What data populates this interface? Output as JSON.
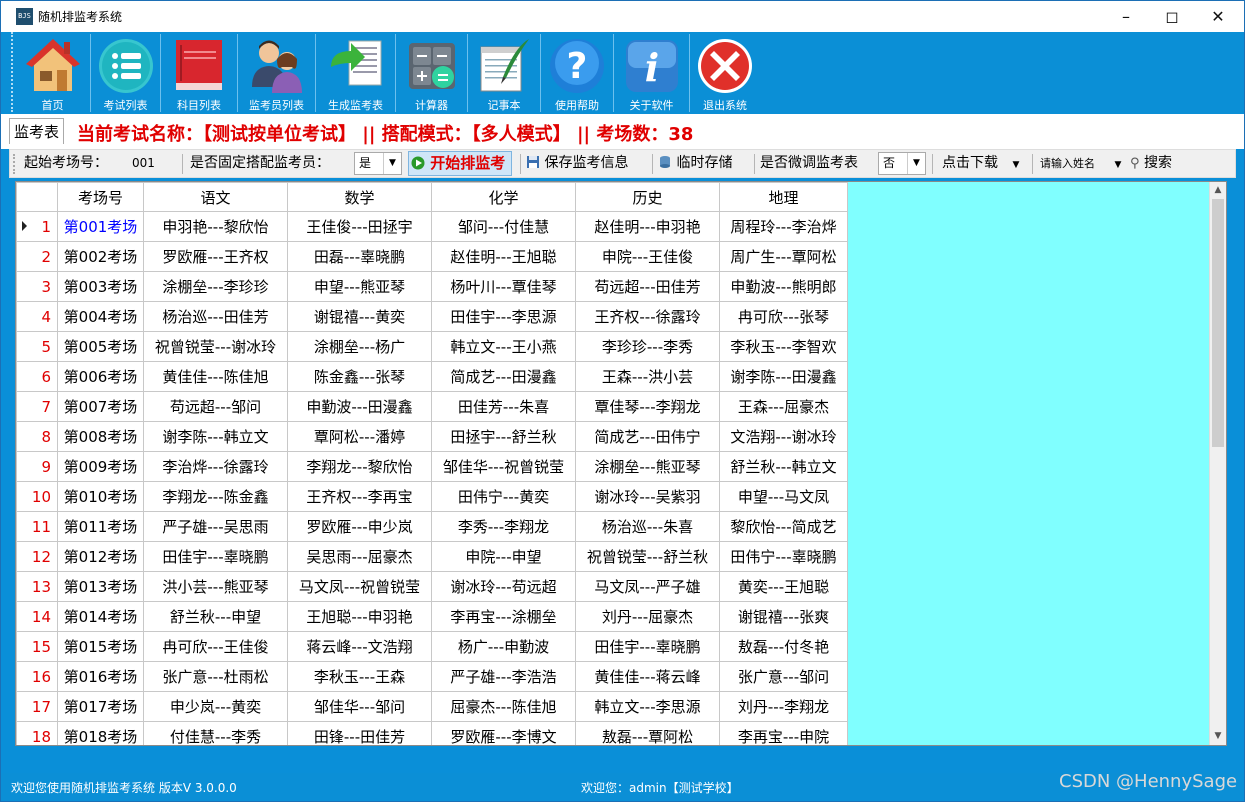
{
  "window": {
    "title": "随机排监考系统",
    "app_icon": "BJS"
  },
  "toolbar": {
    "items": [
      {
        "label": "首页",
        "icon": "home-icon"
      },
      {
        "label": "考试列表",
        "icon": "list-icon"
      },
      {
        "label": "科目列表",
        "icon": "book-icon"
      },
      {
        "label": "监考员列表",
        "icon": "users-icon"
      },
      {
        "label": "生成监考表",
        "icon": "generate-table-icon"
      },
      {
        "label": "计算器",
        "icon": "calculator-icon"
      },
      {
        "label": "记事本",
        "icon": "notepad-icon"
      },
      {
        "label": "使用帮助",
        "icon": "help-icon"
      },
      {
        "label": "关于软件",
        "icon": "info-icon"
      },
      {
        "label": "退出系统",
        "icon": "exit-icon"
      }
    ]
  },
  "info": {
    "tab": "监考表",
    "exam_text": "当前考试名称：【测试按单位考试】 || 搭配模式：【多人模式】 || 考场数：38"
  },
  "controls": {
    "start_room_label": "起始考场号：",
    "start_room_value": "001",
    "fixed_label": "是否固定搭配监考员：",
    "fixed_value": "是",
    "start_btn": "开始排监考",
    "save_btn": "保存监考信息",
    "temp_btn": "临时存储",
    "fine_tune_label": "是否微调监考表",
    "fine_tune_value": "否",
    "download_btn": "点击下载",
    "name_placeholder": "请输入姓名",
    "search_btn": "搜索"
  },
  "table": {
    "headers": [
      "考场号",
      "语文",
      "数学",
      "化学",
      "历史",
      "地理"
    ],
    "rows": [
      {
        "n": "1",
        "cells": [
          "第001考场",
          "申羽艳---黎欣怡",
          "王佳俊---田拯宇",
          "邹问---付佳慧",
          "赵佳明---申羽艳",
          "周程玲---李治烨"
        ]
      },
      {
        "n": "2",
        "cells": [
          "第002考场",
          "罗欧雁---王齐权",
          "田磊---辜晓鹏",
          "赵佳明---王旭聪",
          "申院---王佳俊",
          "周广生---覃阿松"
        ]
      },
      {
        "n": "3",
        "cells": [
          "第003考场",
          "涂棚垒---李珍珍",
          "申望---熊亚琴",
          "杨叶川---覃佳琴",
          "苟远超---田佳芳",
          "申勤波---熊明郎"
        ]
      },
      {
        "n": "4",
        "cells": [
          "第004考场",
          "杨治巡---田佳芳",
          "谢锟禧---黄奕",
          "田佳宇---李思源",
          "王齐权---徐露玲",
          "冉可欣---张琴"
        ]
      },
      {
        "n": "5",
        "cells": [
          "第005考场",
          "祝曾锐莹---谢冰玲",
          "涂棚垒---杨广",
          "韩立文---王小燕",
          "李珍珍---李秀",
          "李秋玉---李智欢"
        ]
      },
      {
        "n": "6",
        "cells": [
          "第006考场",
          "黄佳佳---陈佳旭",
          "陈金鑫---张琴",
          "简成艺---田漫鑫",
          "王森---洪小芸",
          "谢李陈---田漫鑫"
        ]
      },
      {
        "n": "7",
        "cells": [
          "第007考场",
          "苟远超---邹问",
          "申勤波---田漫鑫",
          "田佳芳---朱喜",
          "覃佳琴---李翔龙",
          "王森---屈豪杰"
        ]
      },
      {
        "n": "8",
        "cells": [
          "第008考场",
          "谢李陈---韩立文",
          "覃阿松---潘婷",
          "田拯宇---舒兰秋",
          "简成艺---田伟宁",
          "文浩翔---谢冰玲"
        ]
      },
      {
        "n": "9",
        "cells": [
          "第009考场",
          "李治烨---徐露玲",
          "李翔龙---黎欣怡",
          "邹佳华---祝曾锐莹",
          "涂棚垒---熊亚琴",
          "舒兰秋---韩立文"
        ]
      },
      {
        "n": "10",
        "cells": [
          "第010考场",
          "李翔龙---陈金鑫",
          "王齐权---李再宝",
          "田伟宁---黄奕",
          "谢冰玲---吴紫羽",
          "申望---马文凤"
        ]
      },
      {
        "n": "11",
        "cells": [
          "第011考场",
          "严子雄---吴思雨",
          "罗欧雁---申少岚",
          "李秀---李翔龙",
          "杨治巡---朱喜",
          "黎欣怡---简成艺"
        ]
      },
      {
        "n": "12",
        "cells": [
          "第012考场",
          "田佳宇---辜晓鹏",
          "吴思雨---屈豪杰",
          "申院---申望",
          "祝曾锐莹---舒兰秋",
          "田伟宁---辜晓鹏"
        ]
      },
      {
        "n": "13",
        "cells": [
          "第013考场",
          "洪小芸---熊亚琴",
          "马文凤---祝曾锐莹",
          "谢冰玲---苟远超",
          "马文凤---严子雄",
          "黄奕---王旭聪"
        ]
      },
      {
        "n": "14",
        "cells": [
          "第014考场",
          "舒兰秋---申望",
          "王旭聪---申羽艳",
          "李再宝---涂棚垒",
          "刘丹---屈豪杰",
          "谢锟禧---张爽"
        ]
      },
      {
        "n": "15",
        "cells": [
          "第015考场",
          "冉可欣---王佳俊",
          "蒋云峰---文浩翔",
          "杨广---申勤波",
          "田佳宇---辜晓鹏",
          "敖磊---付冬艳"
        ]
      },
      {
        "n": "16",
        "cells": [
          "第016考场",
          "张广意---杜雨松",
          "李秋玉---王森",
          "严子雄---李浩浩",
          "黄佳佳---蒋云峰",
          "张广意---邹问"
        ]
      },
      {
        "n": "17",
        "cells": [
          "第017考场",
          "申少岚---黄奕",
          "邹佳华---邹问",
          "屈豪杰---陈佳旭",
          "韩立文---李思源",
          "刘丹---李翔龙"
        ]
      },
      {
        "n": "18",
        "cells": [
          "第018考场",
          "付佳慧---李秀",
          "田锋---田佳芳",
          "罗欧雁---李博文",
          "敖磊---覃阿松",
          "李再宝---申院"
        ]
      }
    ]
  },
  "status": {
    "left": "欢迎您使用随机排监考系统  版本V 3.0.0.0",
    "center": "欢迎您：admin【测试学校】"
  },
  "watermark": "CSDN @HennySage",
  "colors": {
    "toolbar_bg": "#0b8fd6",
    "info_red": "#e00000",
    "grid_bg": "#80ffff"
  }
}
